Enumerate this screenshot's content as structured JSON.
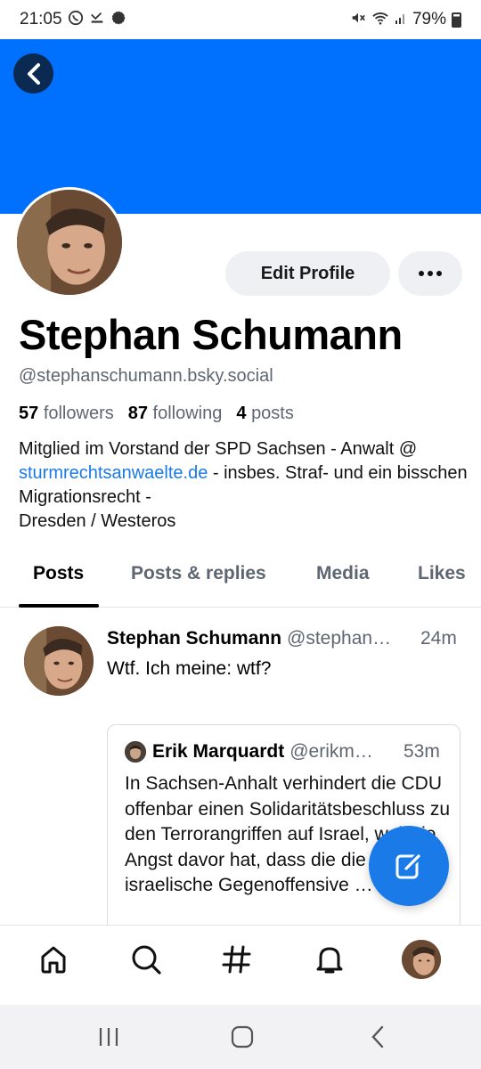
{
  "status_bar": {
    "time": "21:05",
    "battery": "79%",
    "icons": [
      "whatsapp-icon",
      "missed-call-icon",
      "signal-app-icon",
      "mute-icon",
      "wifi-icon",
      "cell-signal-icon",
      "battery-icon"
    ]
  },
  "colors": {
    "banner": "#0070ff",
    "accent": "#1a7ae8",
    "muted_text": "#5e6672"
  },
  "profile": {
    "edit_label": "Edit Profile",
    "display_name": "Stephan Schumann",
    "handle": "@stephanschumann.bsky.social",
    "followers_count": "57",
    "followers_label": "followers",
    "following_count": "87",
    "following_label": "following",
    "posts_count": "4",
    "posts_label": "posts",
    "bio_part1": "Mitglied im Vorstand der SPD Sachsen -  Anwalt @ ",
    "bio_link": "sturmrechtsanwaelte.de",
    "bio_part2": " - insbes. Straf- und ein bisschen Migrationsrecht - ",
    "bio_part3": "Dresden / Westeros"
  },
  "tabs": [
    {
      "label": "Posts",
      "active": true
    },
    {
      "label": "Posts & replies",
      "active": false
    },
    {
      "label": "Media",
      "active": false
    },
    {
      "label": "Likes",
      "active": false
    }
  ],
  "post": {
    "author": "Stephan Schumann",
    "handle": "@stephan…",
    "time": "24m",
    "text": "Wtf. Ich meine: wtf?",
    "quote": {
      "author": "Erik Marquardt",
      "handle": "@erikm…",
      "time": "53m",
      "text": "In Sachsen-Anhalt verhindert die CDU offenbar einen Solidaritätsbeschluss zu den Terrorangriffen auf Israel, weil sie Angst davor hat, dass die die israelische Gegenoffensive …"
    }
  },
  "bottom_nav": [
    "home-icon",
    "search-icon",
    "feeds-hash-icon",
    "notifications-bell-icon",
    "profile-avatar"
  ],
  "system_nav": [
    "recents-icon",
    "home-circle-icon",
    "back-chevron-icon"
  ]
}
